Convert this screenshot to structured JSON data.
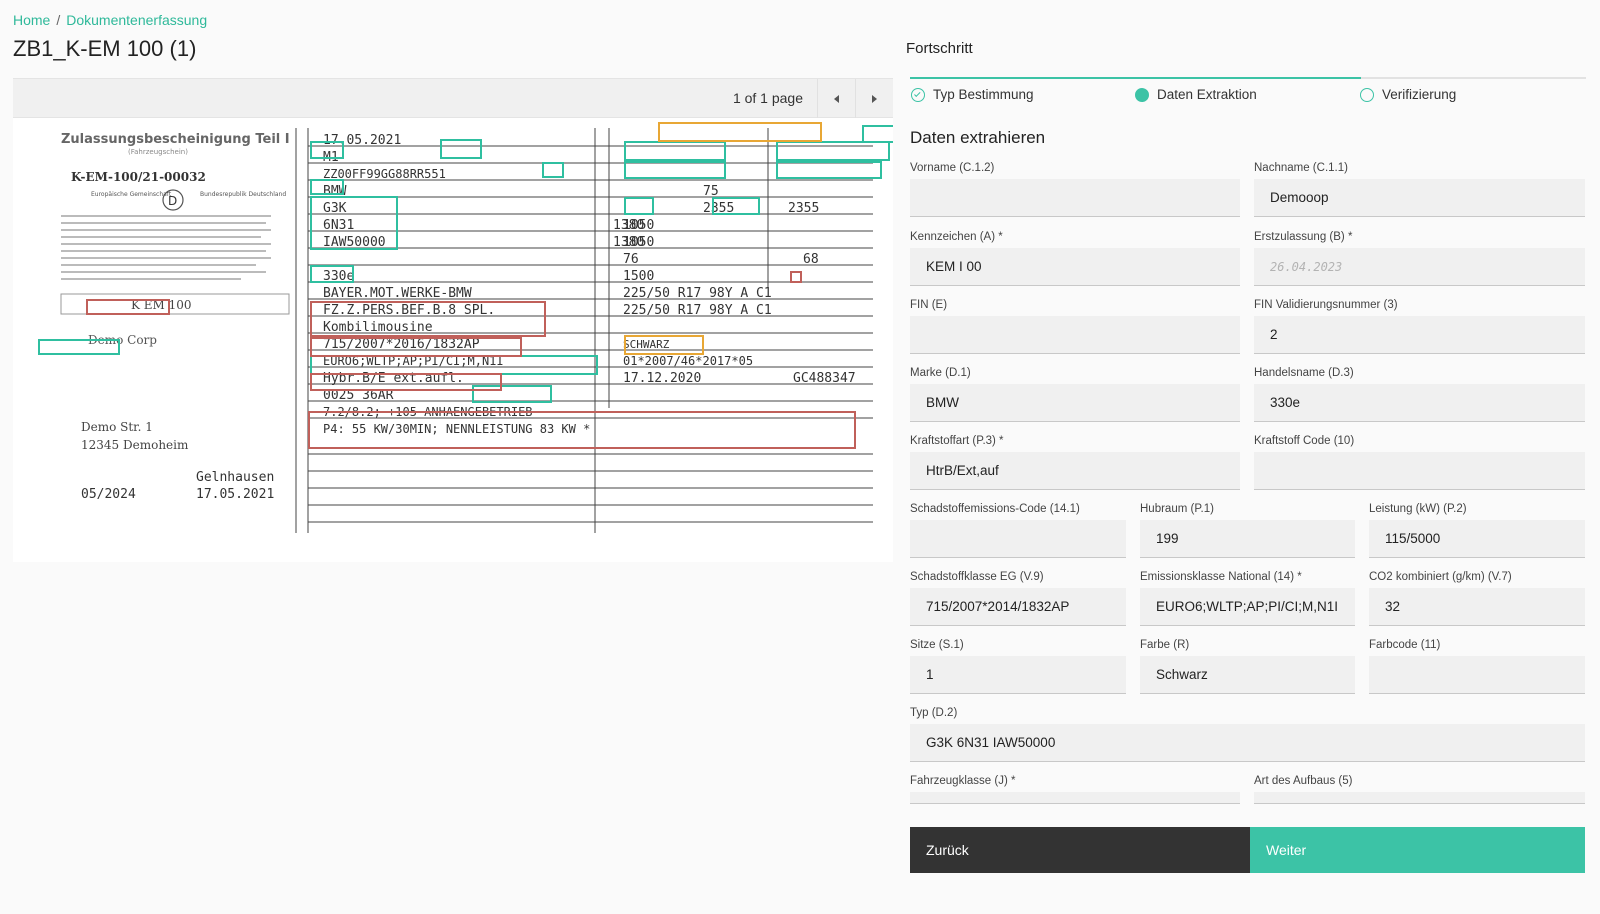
{
  "breadcrumb": {
    "home": "Home",
    "separator": "/",
    "current": "Dokumentenerfassung"
  },
  "document": {
    "title": "ZB1_K-EM 100 (1)"
  },
  "viewer": {
    "page_info": "1 of 1 page"
  },
  "scan": {
    "header_title": "Zulassungsbescheinigung Teil I",
    "header_sub": "(Fahrzeugschein)",
    "doc_number": "K-EM-100/21-00032",
    "country_left": "Europäische Gemeinschaft",
    "country_code": "D",
    "country_right": "Bundesrepublik Deutschland",
    "plate": "K EM 100",
    "owner": "Demo Corp",
    "street": "Demo Str. 1",
    "city": "12345 Demoheim",
    "issue_city": "Gelnhausen",
    "hu_date": "05/2024",
    "issue_date": "17.05.2021",
    "col1": [
      "17.05.2021",
      "M1",
      "ZZ00FF99GG88RR551",
      "BMW",
      "G3K",
      "6N31",
      "IAW50000",
      "330e",
      "BAYER.MOT.WERKE-BMW",
      "FZ.Z.PERS.BEF.B.8 SPL.",
      "Kombilimousine",
      "715/2007*2016/1832AP",
      "EURO6;WLTP;AP;PI/CI;M,N1I",
      "Hybr.B/E ext.aufl.",
      "0025 36AR",
      "7.2/8.2; +105 ANHAENGEBETRIEB",
      "P4: 55 KW/30MIN; NENNLEISTUNG 83 KW *"
    ],
    "col2": [
      "1380",
      "1380",
      "75",
      "2355",
      "1050",
      "1050",
      "76",
      "1500",
      "225/50 R17 98Y A C1",
      "225/50 R17 98Y A C1",
      "SCHWARZ",
      "01*2007/46*2017*05",
      "17.12.2020",
      "GC488347"
    ],
    "col3": [
      "2355",
      "68"
    ]
  },
  "panel": {
    "heading": "Fortschritt",
    "steps": [
      {
        "label": "Typ Bestimmung",
        "state": "done"
      },
      {
        "label": "Daten Extraktion",
        "state": "active"
      },
      {
        "label": "Verifizierung",
        "state": "pending"
      }
    ],
    "section_title": "Daten extrahieren",
    "fields": {
      "vorname": {
        "label": "Vorname (C.1.2)",
        "value": ""
      },
      "nachname": {
        "label": "Nachname (C.1.1)",
        "value": "Demooop"
      },
      "kennzeichen": {
        "label": "Kennzeichen (A) *",
        "value": "KEM I 00"
      },
      "erstzulassung": {
        "label": "Erstzulassung (B) *",
        "placeholder": "26.04.2023"
      },
      "fin": {
        "label": "FIN (E)",
        "value": ""
      },
      "fin_validierung": {
        "label": "FIN Validierungsnummer (3)",
        "value": "2"
      },
      "marke": {
        "label": "Marke (D.1)",
        "value": "BMW"
      },
      "handelsname": {
        "label": "Handelsname (D.3)",
        "value": "330e"
      },
      "kraftstoffart": {
        "label": "Kraftstoffart (P.3) *",
        "value": "HtrB/Ext,auf"
      },
      "kraftstoff_code": {
        "label": "Kraftstoff Code (10)",
        "value": ""
      },
      "schadstoff_code": {
        "label": "Schadstoffemissions-Code (14.1)",
        "value": ""
      },
      "hubraum": {
        "label": "Hubraum (P.1)",
        "value": "199"
      },
      "leistung": {
        "label": "Leistung (kW) (P.2)",
        "value": "115/5000"
      },
      "schadstoffklasse": {
        "label": "Schadstoffklasse EG (V.9)",
        "value": "715/2007*2014/1832AP"
      },
      "emissionsklasse": {
        "label": "Emissionsklasse National (14) *",
        "value": "EURO6;WLTP;AP;PI/CI;M,N1I"
      },
      "co2": {
        "label": "CO2 kombiniert (g/km) (V.7)",
        "value": "32"
      },
      "sitze": {
        "label": "Sitze (S.1)",
        "value": "1"
      },
      "farbe": {
        "label": "Farbe (R)",
        "value": "Schwarz"
      },
      "farbcode": {
        "label": "Farbcode (11)",
        "value": ""
      },
      "typ": {
        "label": "Typ (D.2)",
        "value": "G3K 6N31 IAW50000"
      },
      "fahrzeugklasse": {
        "label": "Fahrzeugklasse (J) *",
        "value": ""
      },
      "art_aufbau": {
        "label": "Art des Aufbaus (5)",
        "value": ""
      }
    },
    "back_label": "Zurück",
    "next_label": "Weiter"
  },
  "colors": {
    "accent": "#3cc3a6",
    "box_teal": "#2fbfa0",
    "box_red": "#c0605a",
    "box_orange": "#e8a735",
    "dark_button": "#333333"
  }
}
